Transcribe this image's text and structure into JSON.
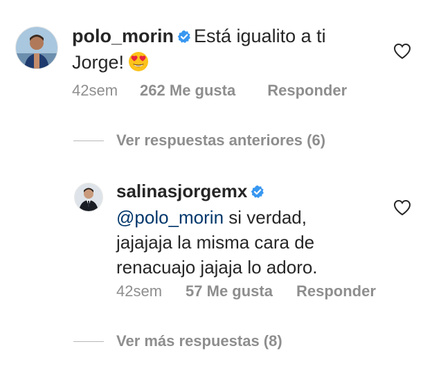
{
  "comment1": {
    "username": "polo_morin",
    "text_line1": "Está igualito a ti",
    "text_line2": "Jorge!",
    "emoji": "smiling-face-with-heart-eyes",
    "time": "42sem",
    "likes": "262 Me gusta",
    "reply_label": "Responder"
  },
  "view_previous": {
    "label": "Ver respuestas anteriores (6)"
  },
  "comment2": {
    "username": "salinasjorgemx",
    "mention": "@polo_morin",
    "text_line1_rest": " si verdad,",
    "text_line2": "jajajaja la misma cara de",
    "text_line3": "renacuajo jajaja lo adoro.",
    "time": "42sem",
    "likes": "57 Me gusta",
    "reply_label": "Responder"
  },
  "view_more": {
    "label": "Ver más respuestas (8)"
  },
  "colors": {
    "verified_blue": "#3897f0",
    "mention_blue": "#00376b",
    "meta_gray": "#8e8e8e"
  }
}
